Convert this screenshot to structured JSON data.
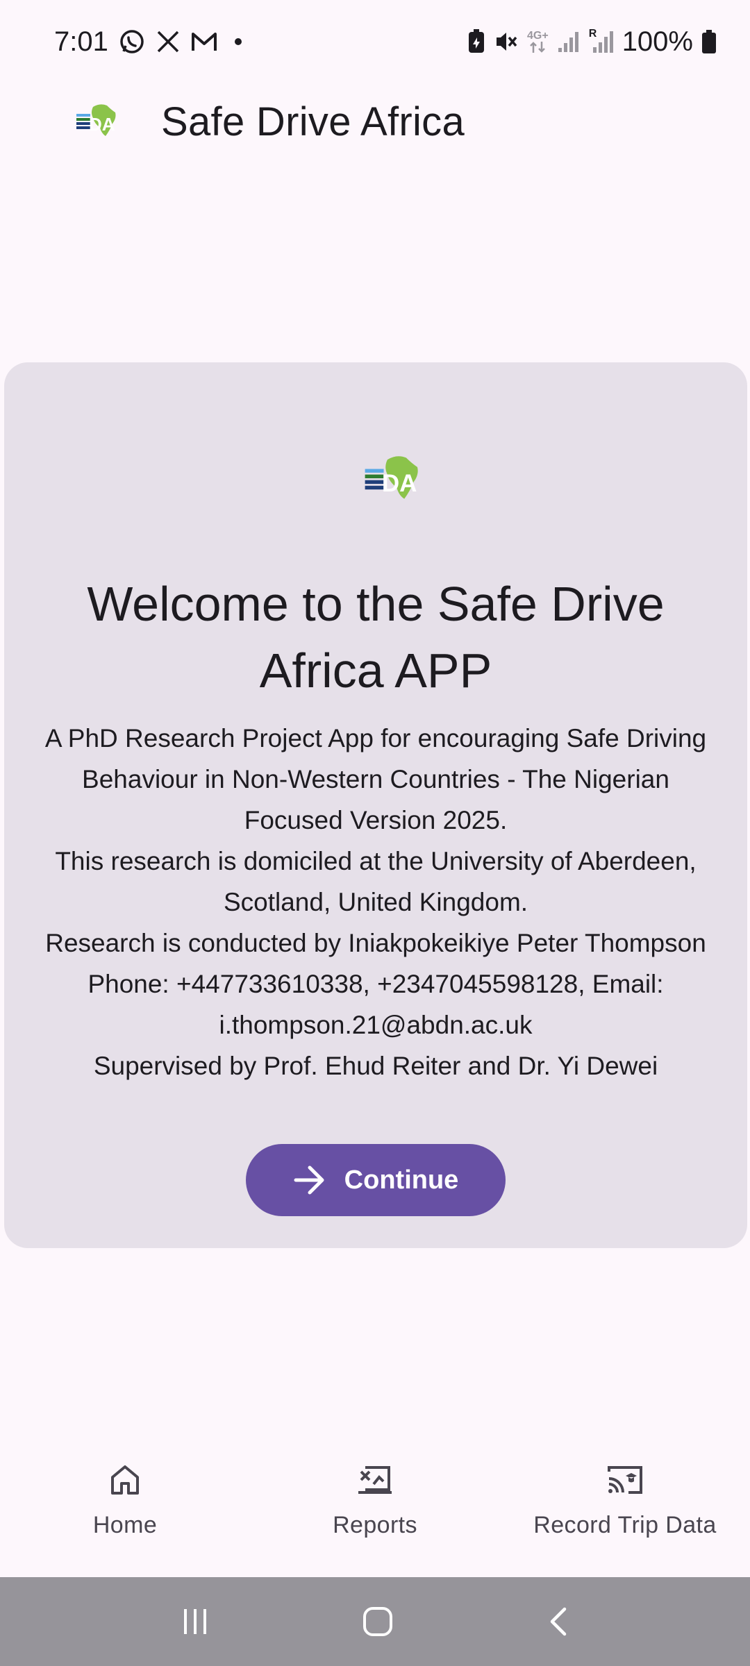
{
  "status_bar": {
    "time": "7:01",
    "network": "4G+",
    "roaming": "R",
    "battery": "100%",
    "icons": [
      "whatsapp-icon",
      "x-icon",
      "gmail-icon",
      "notification-dot",
      "battery-saver-icon",
      "mute-icon",
      "network-icon",
      "signal-icon",
      "signal-roaming-icon",
      "battery-icon"
    ]
  },
  "app_bar": {
    "title": "Safe Drive Africa",
    "logo": "sda-logo"
  },
  "card": {
    "title": "Welcome to the Safe Drive Africa APP",
    "lines": [
      "A PhD Research Project App for encouraging Safe Driving Behaviour in Non-Western Countries - The Nigerian Focused Version 2025.",
      "This research is domiciled at the University of Aberdeen, Scotland, United Kingdom.",
      "Research is conducted by Iniakpokeikiye Peter Thompson",
      "Phone: +447733610338, +2347045598128, Email: i.thompson.21@abdn.ac.uk",
      "Supervised by Prof. Ehud Reiter and Dr. Yi Dewei"
    ],
    "continue_label": "Continue",
    "continue_icon": "arrow-forward-icon"
  },
  "bottom_nav": {
    "items": [
      {
        "label": "Home",
        "icon": "home-icon"
      },
      {
        "label": "Reports",
        "icon": "reports-icon"
      },
      {
        "label": "Record Trip Data",
        "icon": "record-trip-icon"
      }
    ]
  },
  "system_nav": {
    "icons": [
      "recents-icon",
      "home-circle-icon",
      "back-icon"
    ]
  },
  "colors": {
    "background": "#fdf7fc",
    "card": "#e6e0e9",
    "primary": "#6750a4",
    "on_surface": "#1d1b20",
    "nav_text": "#49454f",
    "system_nav": "#96949a"
  }
}
